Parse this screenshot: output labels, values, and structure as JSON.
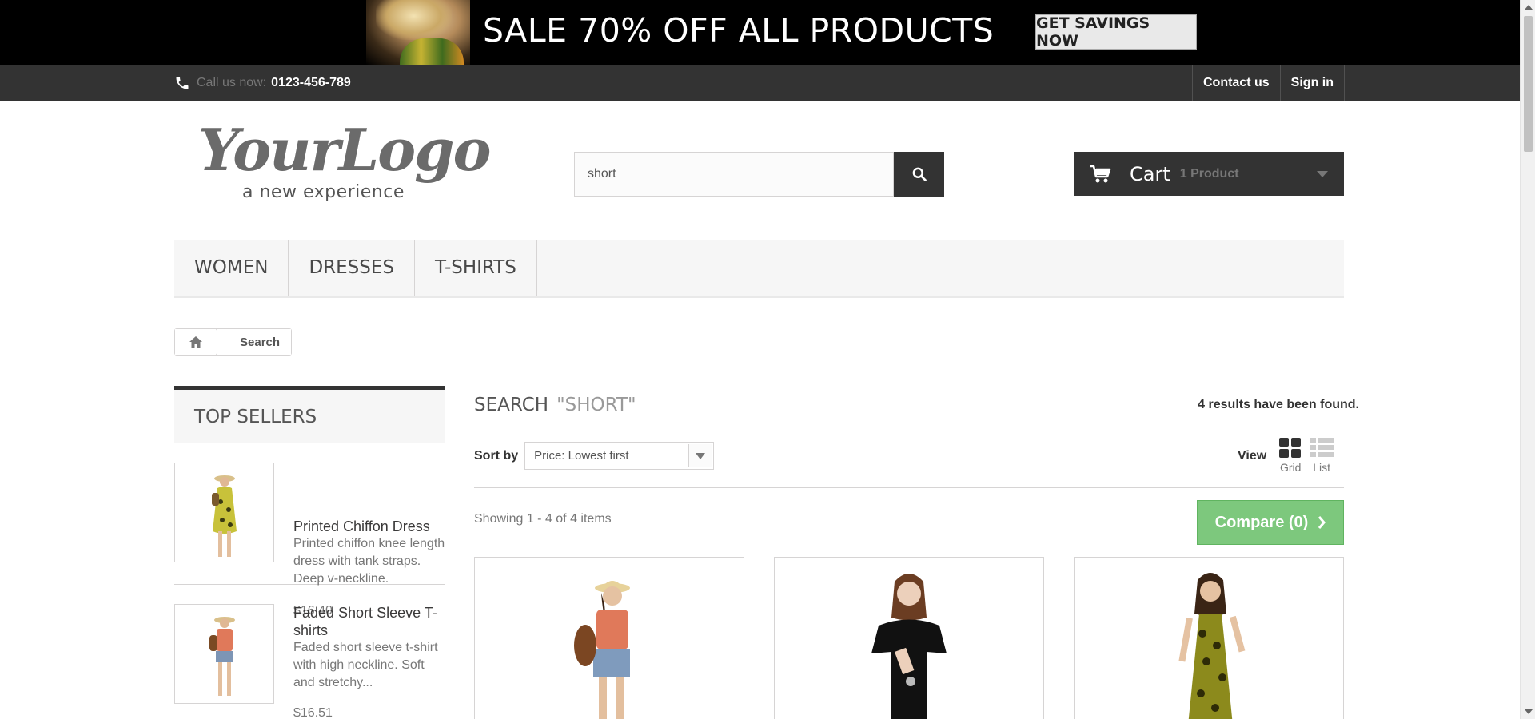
{
  "banner": {
    "headline": "SALE 70% OFF ALL PRODUCTS",
    "cta_label": "GET SAVINGS NOW"
  },
  "topnav": {
    "phone_label": "Call us now:",
    "phone_number": "0123-456-789",
    "contact_label": "Contact us",
    "signin_label": "Sign in"
  },
  "logo": {
    "main": "YourLogo",
    "tagline": "a new experience"
  },
  "search": {
    "value": "short",
    "button_icon": "search-icon"
  },
  "cart": {
    "label": "Cart",
    "quantity": "1 Product"
  },
  "menu": {
    "items": [
      {
        "label": "WOMEN"
      },
      {
        "label": "DRESSES"
      },
      {
        "label": "T-SHIRTS"
      }
    ]
  },
  "breadcrumb": {
    "home_icon": "home-icon",
    "current": "Search"
  },
  "sidebar": {
    "title": "TOP SELLERS",
    "items": [
      {
        "name": "Printed Chiffon Dress",
        "description": "Printed chiffon knee length dress with tank straps. Deep v-neckline.",
        "price": "$16.40"
      },
      {
        "name": "Faded Short Sleeve T-shirts",
        "description": "Faded short sleeve t-shirt with high neckline. Soft and stretchy...",
        "price": "$16.51"
      }
    ]
  },
  "main": {
    "title": "SEARCH",
    "query": "\"SHORT\"",
    "results_count": "4 results have been found.",
    "sort_label": "Sort by",
    "sort_value": "Price: Lowest first",
    "view_label": "View",
    "view_grid": "Grid",
    "view_list": "List",
    "showing": "Showing 1 - 4 of 4 items",
    "compare_label": "Compare (0)"
  },
  "colors": {
    "dark": "#333333",
    "compare_green": "#7dc87d"
  }
}
